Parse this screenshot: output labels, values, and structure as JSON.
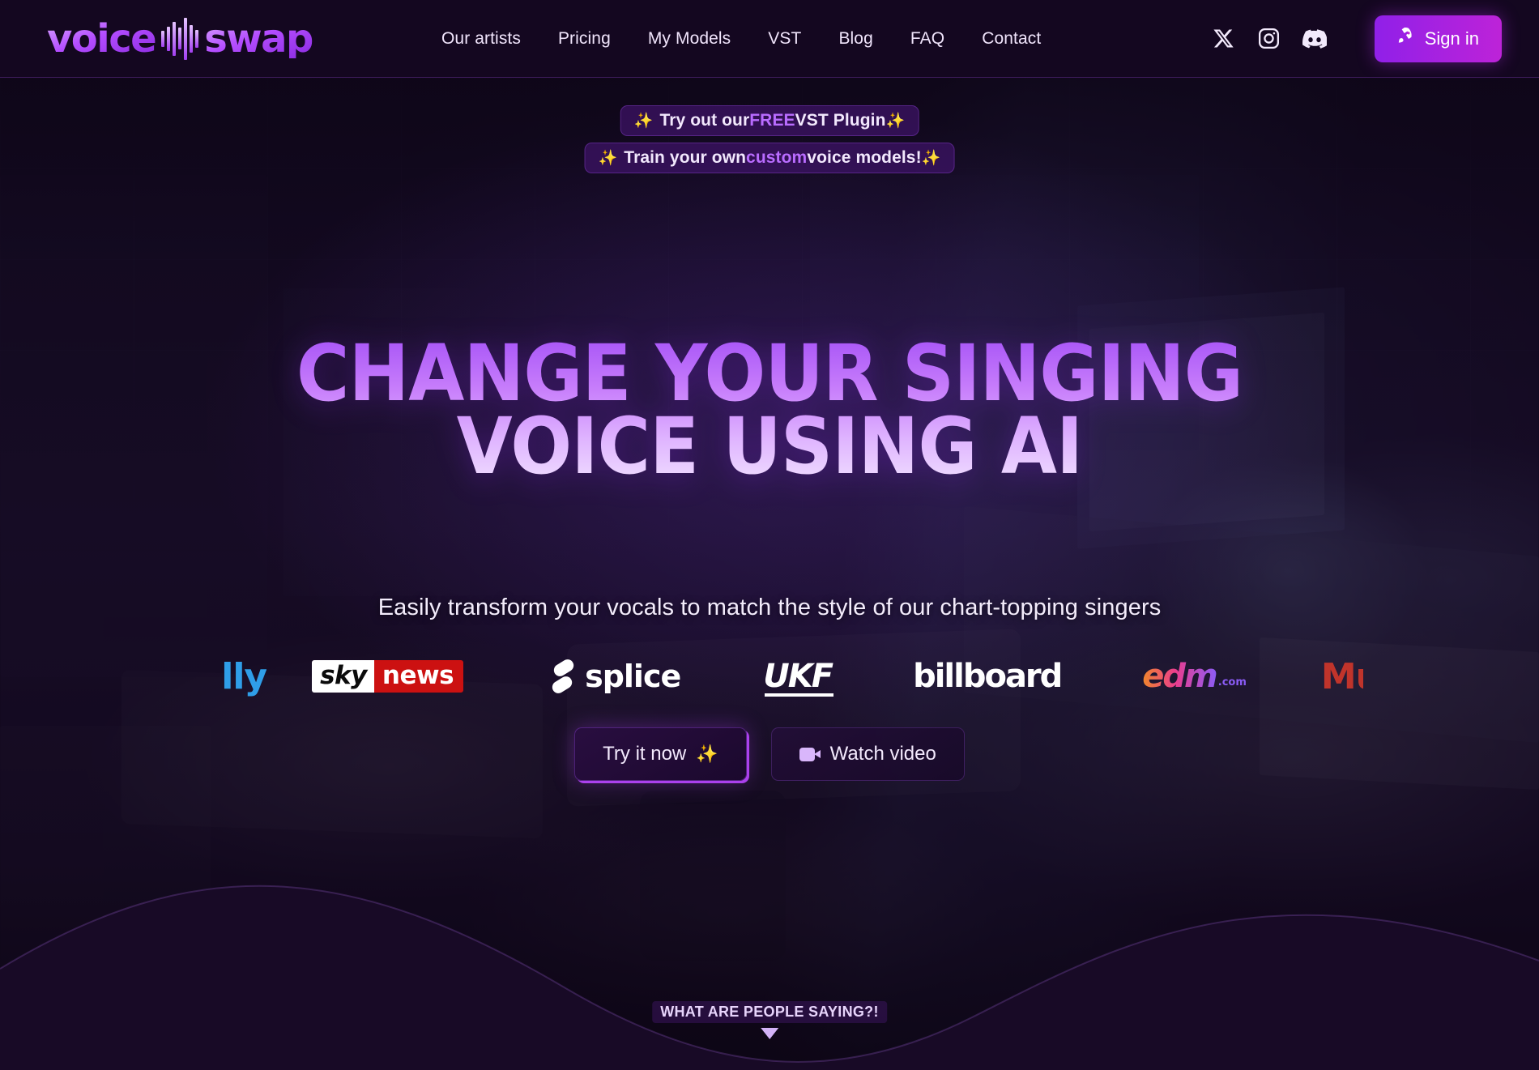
{
  "brand": {
    "name_part1": "voice",
    "name_part2": "swap",
    "accent": "#a855f7"
  },
  "nav": {
    "links": [
      {
        "label": "Our artists"
      },
      {
        "label": "Pricing"
      },
      {
        "label": "My Models"
      },
      {
        "label": "VST"
      },
      {
        "label": "Blog"
      },
      {
        "label": "FAQ"
      },
      {
        "label": "Contact"
      }
    ],
    "social": [
      {
        "name": "x-twitter-icon",
        "label": "X"
      },
      {
        "name": "instagram-icon",
        "label": "Instagram"
      },
      {
        "name": "discord-icon",
        "label": "Discord"
      }
    ],
    "signin": {
      "label": "Sign in",
      "icon": "rocket-icon",
      "gradient_from": "#9020e8",
      "gradient_to": "#bd23d8"
    }
  },
  "banners": [
    {
      "sparkle_left": "✨",
      "pre": "Try out our ",
      "highlight": "FREE",
      "post": " VST Plugin ",
      "sparkle_right": "✨",
      "highlight_color": "#b96cff"
    },
    {
      "sparkle_left": "✨",
      "pre": "Train your own ",
      "highlight": "custom",
      "post": " voice models! ",
      "sparkle_right": "✨",
      "highlight_color": "#b96cff"
    }
  ],
  "hero": {
    "headline_line1": "CHANGE YOUR SINGING",
    "headline_line2": "VOICE USING AI",
    "subtitle": "Easily transform your vocals to match the style of our chart-topping singers",
    "headline_gradient_from": "#a855f7",
    "headline_gradient_to": "#efdcff"
  },
  "press_logos": [
    {
      "name": "partial-lly-logo",
      "text": "lly",
      "color": "#2f9ee8"
    },
    {
      "name": "sky-news-logo",
      "text1": "sky",
      "text2": "news",
      "color1": "#ffffff",
      "color2": "#cc1111"
    },
    {
      "name": "splice-logo",
      "text": "splice",
      "color": "#ffffff"
    },
    {
      "name": "ukf-logo",
      "text": "UKF",
      "color": "#ffffff"
    },
    {
      "name": "billboard-logo",
      "text": "billboard",
      "color": "#ffffff"
    },
    {
      "name": "edm-com-logo",
      "text": "edm",
      "suffix": ".com",
      "color": "#ea3d8e"
    },
    {
      "name": "partial-mu-logo",
      "text": "Mu",
      "color": "#c0342b"
    }
  ],
  "ctas": [
    {
      "name": "try-it-now-button",
      "label": "Try it now",
      "sparkle": "✨"
    },
    {
      "name": "watch-video-button",
      "label": "Watch video",
      "icon": "video-camera-icon"
    }
  ],
  "footer_prompt": {
    "label": "WHAT ARE PEOPLE SAYING?!",
    "arrow": "▼"
  }
}
